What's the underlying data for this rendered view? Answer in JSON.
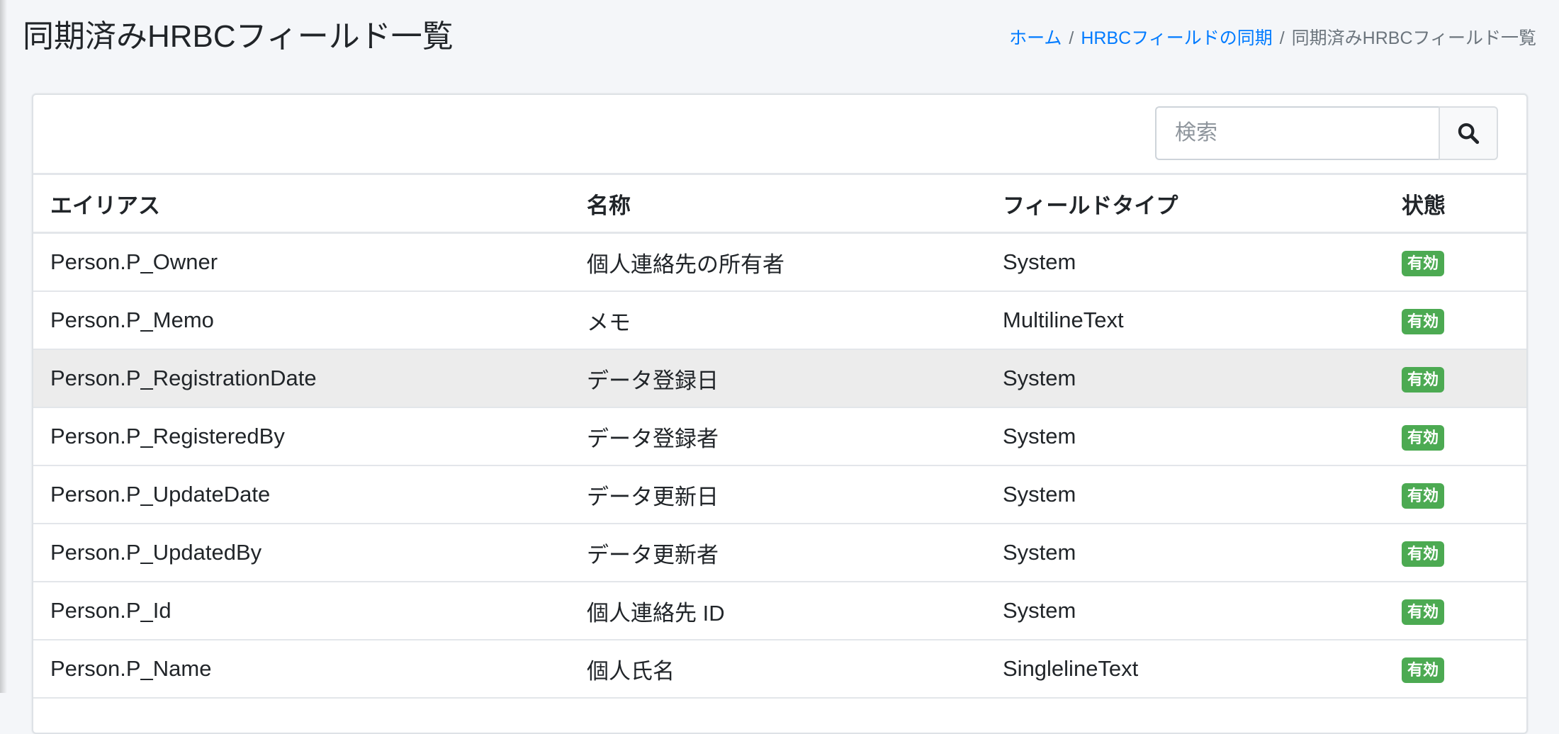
{
  "page": {
    "title": "同期済みHRBCフィールド一覧"
  },
  "breadcrumb": {
    "home": "ホーム",
    "sync": "HRBCフィールドの同期",
    "current": "同期済みHRBCフィールド一覧",
    "separator": "/"
  },
  "search": {
    "placeholder": "検索",
    "icon": "search-icon"
  },
  "table": {
    "headers": [
      "エイリアス",
      "名称",
      "フィールドタイプ",
      "状態"
    ],
    "rows": [
      {
        "alias": "Person.P_Owner",
        "name": "個人連絡先の所有者",
        "type": "System",
        "status": "有効"
      },
      {
        "alias": "Person.P_Memo",
        "name": "メモ",
        "type": "MultilineText",
        "status": "有効"
      },
      {
        "alias": "Person.P_RegistrationDate",
        "name": "データ登録日",
        "type": "System",
        "status": "有効"
      },
      {
        "alias": "Person.P_RegisteredBy",
        "name": "データ登録者",
        "type": "System",
        "status": "有効"
      },
      {
        "alias": "Person.P_UpdateDate",
        "name": "データ更新日",
        "type": "System",
        "status": "有効"
      },
      {
        "alias": "Person.P_UpdatedBy",
        "name": "データ更新者",
        "type": "System",
        "status": "有効"
      },
      {
        "alias": "Person.P_Id",
        "name": "個人連絡先 ID",
        "type": "System",
        "status": "有効"
      },
      {
        "alias": "Person.P_Name",
        "name": "個人氏名",
        "type": "SinglelineText",
        "status": "有効"
      }
    ]
  },
  "colors": {
    "link": "#007bff",
    "badge_success": "#4caa52",
    "row_highlight": "#ececec",
    "background": "#f4f6f9"
  }
}
